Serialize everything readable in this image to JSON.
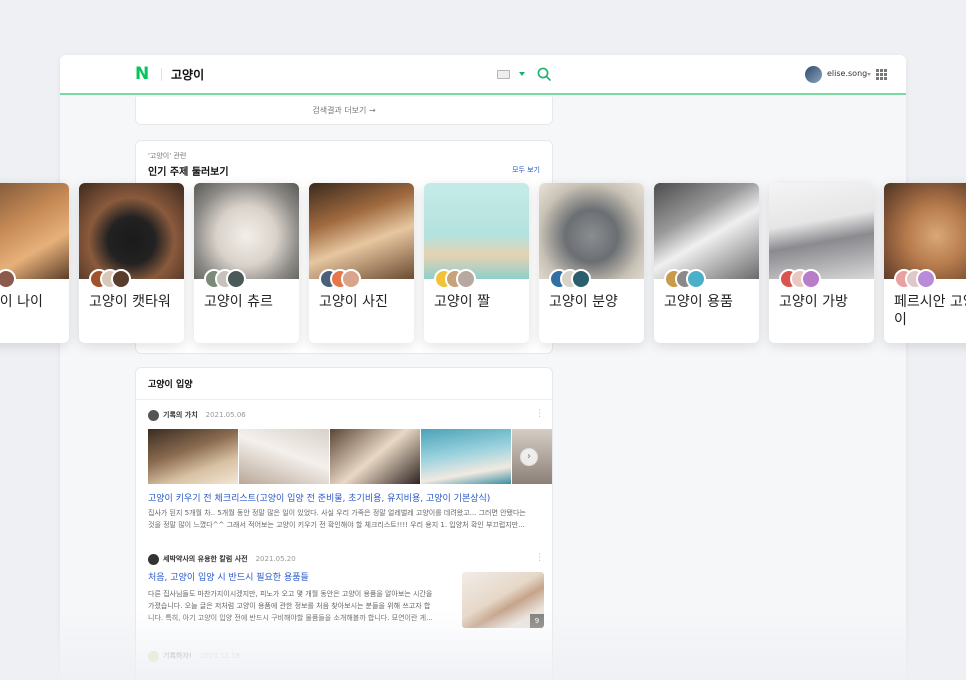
{
  "header": {
    "logo": "N",
    "query": "고양이",
    "user": "elise.song"
  },
  "search_more": {
    "label": "검색결과 더보기 →"
  },
  "topics": {
    "subtitle": "'고양이' 관련",
    "title": "인기 주제 둘러보기",
    "see_all": "모두 보기",
    "items": [
      {
        "label": "고양이 나이"
      },
      {
        "label": "고양이 캣타워"
      },
      {
        "label": "고양이 츄르"
      },
      {
        "label": "고양이 사진"
      },
      {
        "label": "고양이 짤"
      },
      {
        "label": "고양이 분양"
      },
      {
        "label": "고양이 용품"
      },
      {
        "label": "고양이 가방"
      },
      {
        "label": "페르시안 고양이"
      }
    ]
  },
  "section": {
    "title": "고양이 입양",
    "posts": [
      {
        "author": "기록의 가치",
        "date": "2021.05.06",
        "title": "고양이 키우기 전 체크리스트(고양이 입양 전 준비물, 초기비용, 유지비용, 고양이 기본상식)",
        "desc_1": "집사가 된지 5개월 차.. 5개월 동안 정말 많은 일이 있었다. 사실 우리 가족은 정말 얼레벌레 고양이를 데려왔고... 그러면 안됐다는",
        "desc_2": "것을 정말 많이 느꼈다^^ 그래서 적어보는 고양이 키우기 전 확인해야 할 체크리스트!!!! 우리 용지 1. 입양처 확인 부끄럽지만..."
      },
      {
        "author": "세박약사의 유용한 칼럼 사전",
        "date": "2021.05.20",
        "title": "처음, 고양이 입양 시 반드시 필요한 용품들",
        "desc_1": "다른 집사님들도 마찬가지이시겠지만, 피노가 오고 몇 개월 동안은 고양이 용품을 알아보는 시간을",
        "desc_2": "가졌습니다. 오늘 글은 저처럼 고양이 용품에 관한 정보를 처음 찾아보시는 분들을 위해 쓰고자 합",
        "desc_3": "니다. 특히, 아기 고양이 입양 전에 반드시 구비해야할 물품들을 소개해볼까 합니다. 묘연이란 게...",
        "thumb_count": "9"
      },
      {
        "author": "기록하자!",
        "date": "2020.12.18"
      }
    ]
  }
}
